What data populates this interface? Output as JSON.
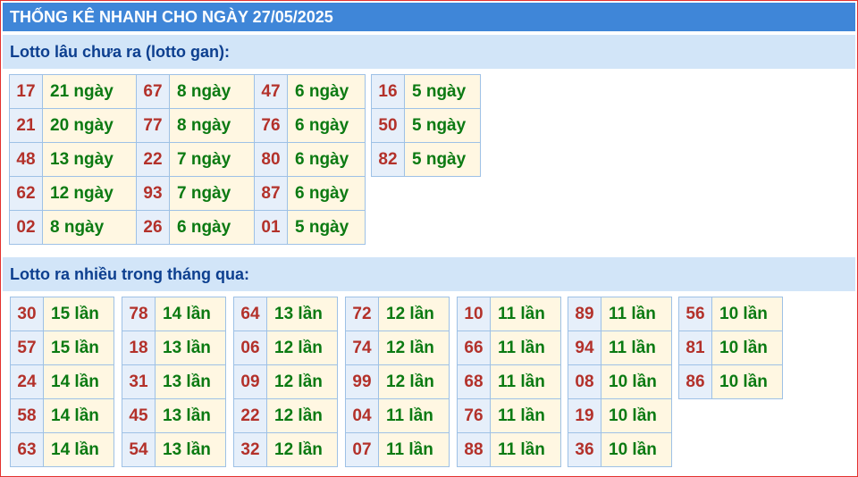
{
  "header": {
    "title": "THỐNG KÊ NHANH CHO NGÀY 27/05/2025"
  },
  "gan": {
    "title": "Lotto lâu chưa ra (lotto gan):",
    "columns": [
      [
        {
          "num": "17",
          "val": "21 ngày"
        },
        {
          "num": "21",
          "val": "20 ngày"
        },
        {
          "num": "48",
          "val": "13 ngày"
        },
        {
          "num": "62",
          "val": "12 ngày"
        },
        {
          "num": "02",
          "val": "8 ngày"
        }
      ],
      [
        {
          "num": "67",
          "val": "8 ngày"
        },
        {
          "num": "77",
          "val": "8 ngày"
        },
        {
          "num": "22",
          "val": "7 ngày"
        },
        {
          "num": "93",
          "val": "7 ngày"
        },
        {
          "num": "26",
          "val": "6 ngày"
        }
      ],
      [
        {
          "num": "47",
          "val": "6 ngày"
        },
        {
          "num": "76",
          "val": "6 ngày"
        },
        {
          "num": "80",
          "val": "6 ngày"
        },
        {
          "num": "87",
          "val": "6 ngày"
        },
        {
          "num": "01",
          "val": "5 ngày"
        }
      ],
      [
        {
          "num": "16",
          "val": "5 ngày"
        },
        {
          "num": "50",
          "val": "5 ngày"
        },
        {
          "num": "82",
          "val": "5 ngày"
        }
      ]
    ]
  },
  "nhieu": {
    "title": "Lotto ra nhiều trong tháng qua:",
    "columns": [
      [
        {
          "num": "30",
          "val": "15 lần"
        },
        {
          "num": "57",
          "val": "15 lần"
        },
        {
          "num": "24",
          "val": "14 lần"
        },
        {
          "num": "58",
          "val": "14 lần"
        },
        {
          "num": "63",
          "val": "14 lần"
        }
      ],
      [
        {
          "num": "78",
          "val": "14 lần"
        },
        {
          "num": "18",
          "val": "13 lần"
        },
        {
          "num": "31",
          "val": "13 lần"
        },
        {
          "num": "45",
          "val": "13 lần"
        },
        {
          "num": "54",
          "val": "13 lần"
        }
      ],
      [
        {
          "num": "64",
          "val": "13 lần"
        },
        {
          "num": "06",
          "val": "12 lần"
        },
        {
          "num": "09",
          "val": "12 lần"
        },
        {
          "num": "22",
          "val": "12 lần"
        },
        {
          "num": "32",
          "val": "12 lần"
        }
      ],
      [
        {
          "num": "72",
          "val": "12 lần"
        },
        {
          "num": "74",
          "val": "12 lần"
        },
        {
          "num": "99",
          "val": "12 lần"
        },
        {
          "num": "04",
          "val": "11 lần"
        },
        {
          "num": "07",
          "val": "11 lần"
        }
      ],
      [
        {
          "num": "10",
          "val": "11 lần"
        },
        {
          "num": "66",
          "val": "11 lần"
        },
        {
          "num": "68",
          "val": "11 lần"
        },
        {
          "num": "76",
          "val": "11 lần"
        },
        {
          "num": "88",
          "val": "11 lần"
        }
      ],
      [
        {
          "num": "89",
          "val": "11 lần"
        },
        {
          "num": "94",
          "val": "11 lần"
        },
        {
          "num": "08",
          "val": "10 lần"
        },
        {
          "num": "19",
          "val": "10 lần"
        },
        {
          "num": "36",
          "val": "10 lần"
        }
      ],
      [
        {
          "num": "56",
          "val": "10 lần"
        },
        {
          "num": "81",
          "val": "10 lần"
        },
        {
          "num": "86",
          "val": "10 lần"
        }
      ]
    ]
  }
}
